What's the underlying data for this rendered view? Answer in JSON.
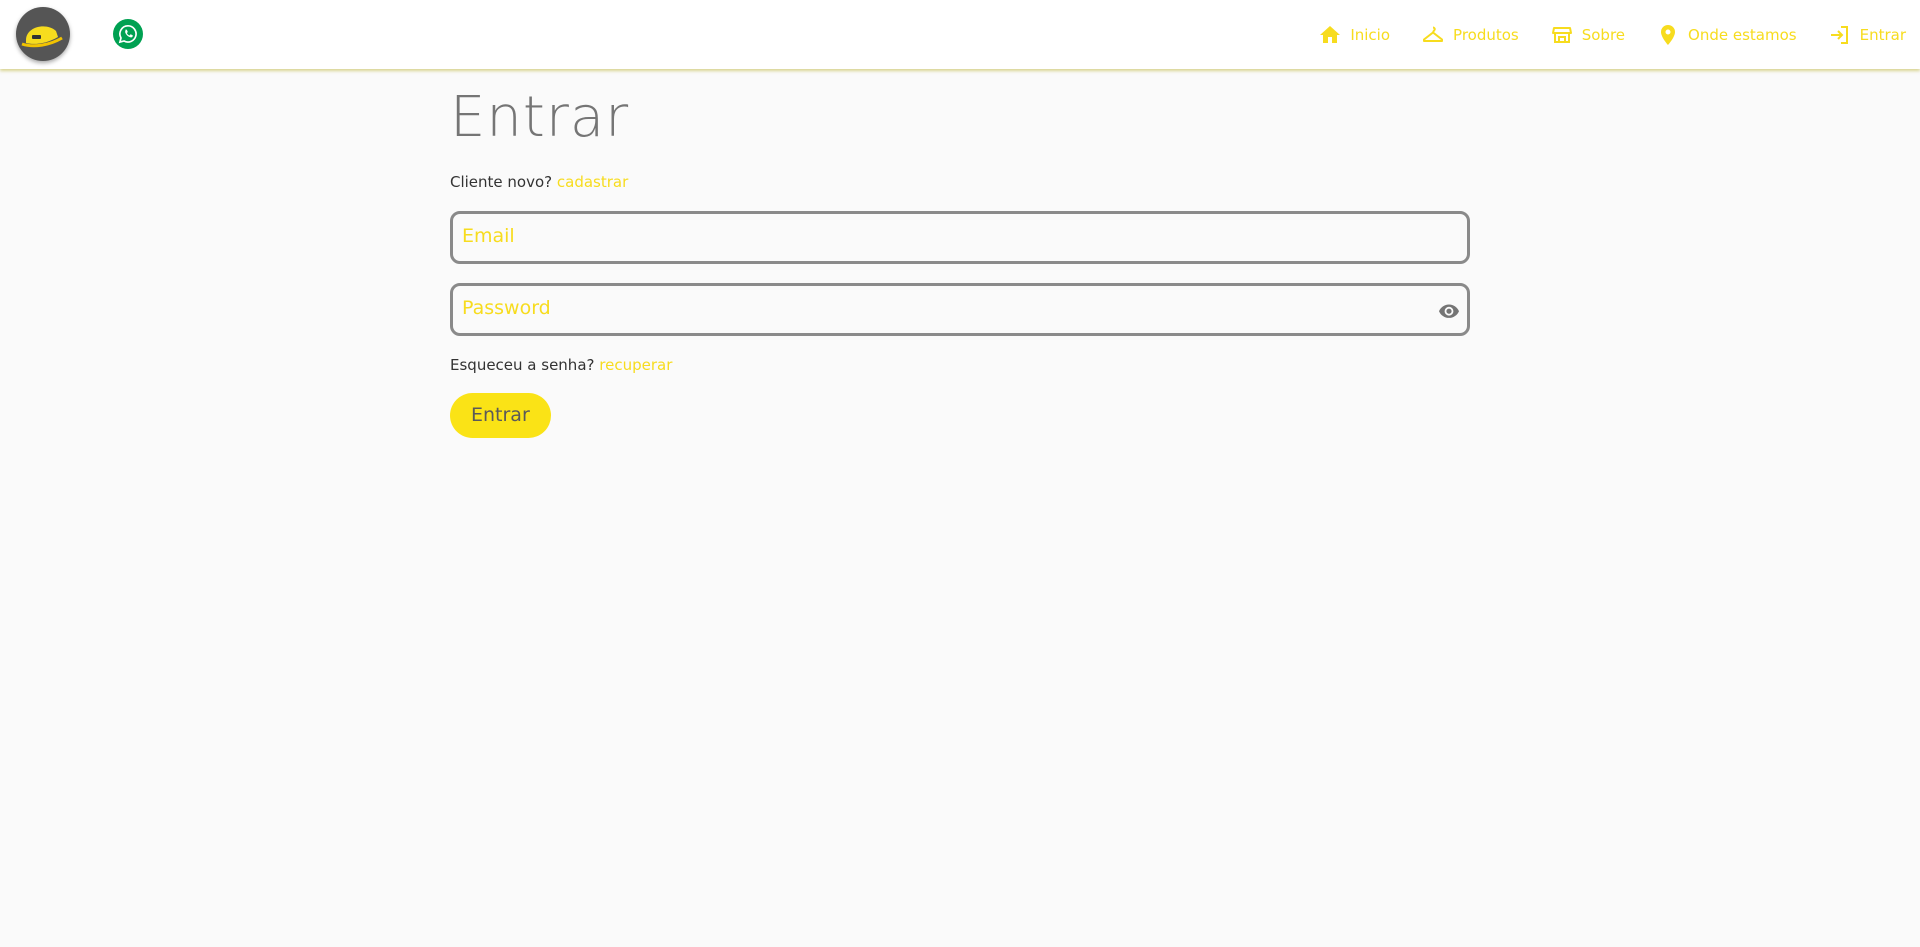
{
  "header": {
    "logo_icon": "hard-hat-logo",
    "whatsapp_icon": "whatsapp-icon",
    "nav": [
      {
        "icon": "home-icon",
        "label": "Inicio"
      },
      {
        "icon": "hanger-icon",
        "label": "Produtos"
      },
      {
        "icon": "store-icon",
        "label": "Sobre"
      },
      {
        "icon": "location-pin-icon",
        "label": "Onde estamos"
      },
      {
        "icon": "login-icon",
        "label": "Entrar"
      }
    ]
  },
  "login": {
    "title": "Entrar",
    "signup_prompt": "Cliente novo?",
    "signup_link": "cadastrar",
    "email_placeholder": "Email",
    "password_placeholder": "Password",
    "password_toggle_icon": "eye-icon",
    "forgot_prompt": "Esqueceu a senha?",
    "forgot_link": "recuperar",
    "submit_label": "Entrar"
  },
  "colors": {
    "accent": "#f7dc1e",
    "button_bg": "#fae316",
    "whatsapp": "#00a152",
    "title": "#757575",
    "background": "#fafafa"
  }
}
